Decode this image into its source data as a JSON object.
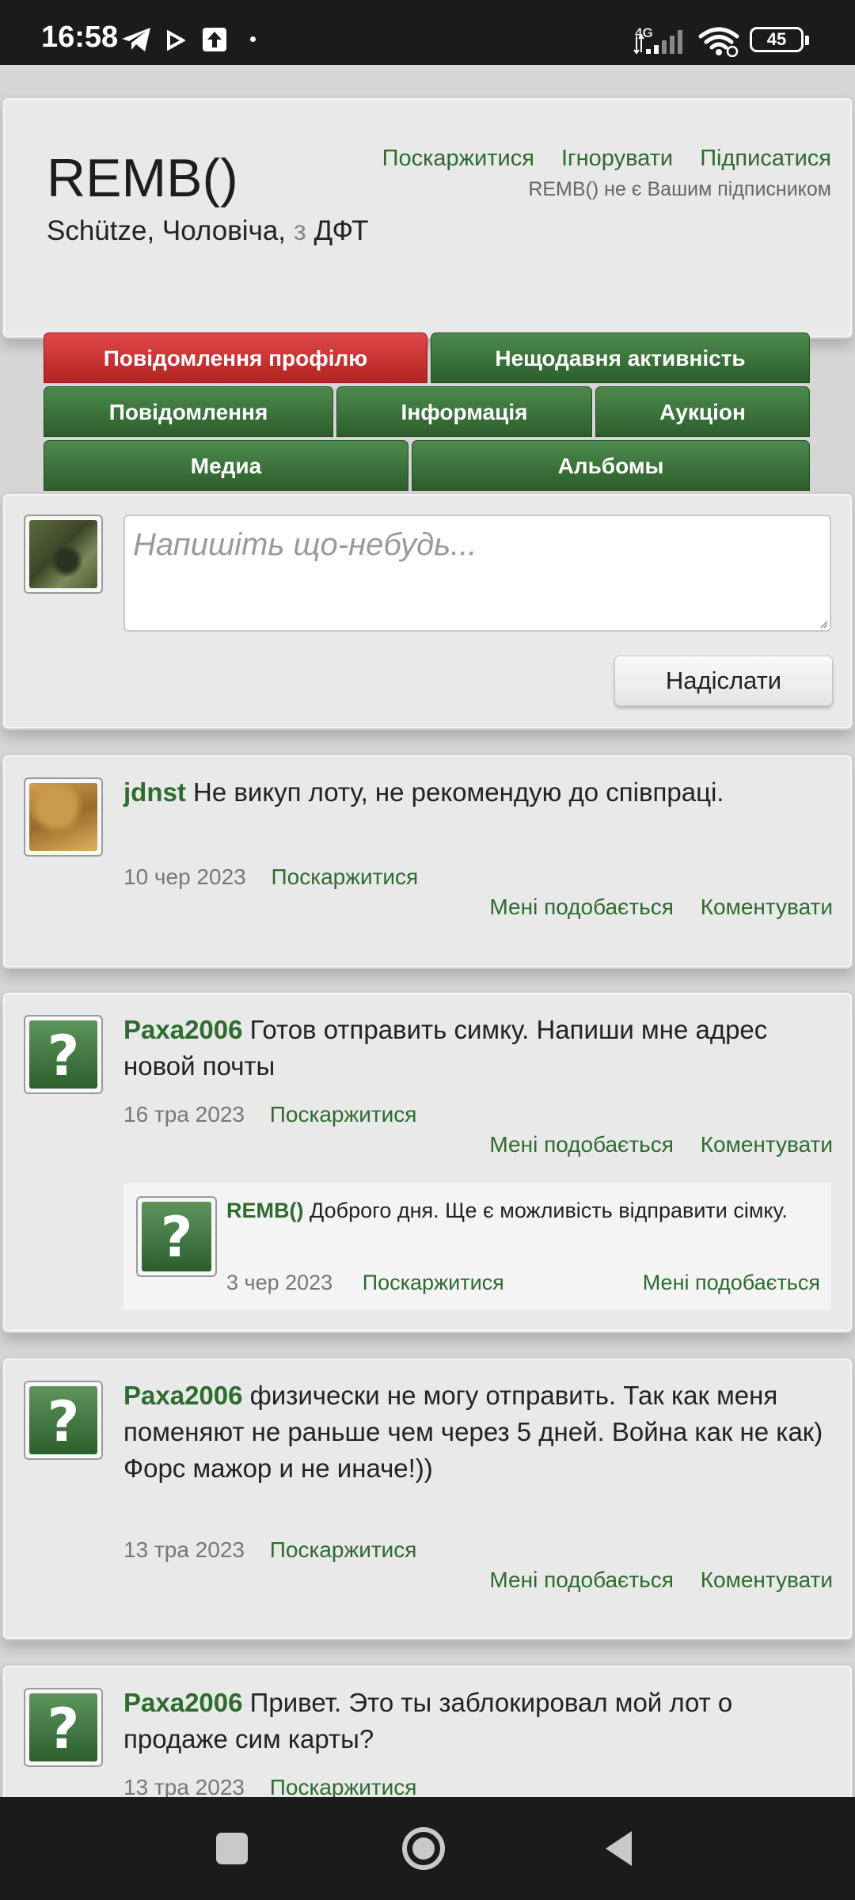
{
  "status": {
    "time": "16:58",
    "network": "4G",
    "battery": "45",
    "icons": [
      "telegram-icon",
      "play-icon",
      "upload-icon",
      "signal-icon",
      "wifi-icon",
      "battery-icon"
    ]
  },
  "profile": {
    "name": "REMB()",
    "subtitle_prefix": "Schütze, Чоловіча,",
    "subtitle_from": "з",
    "subtitle_place": "ДФТ",
    "links": {
      "report": "Поскаржитися",
      "ignore": "Ігнорувати",
      "follow": "Підписатися"
    },
    "follow_note": "REMB() не є Вашим підписником"
  },
  "tabs": {
    "profile_posts": "Повідомлення профілю",
    "recent_activity": "Нещодавня активність",
    "messages": "Повідомлення",
    "information": "Інформація",
    "auction": "Аукціон",
    "media": "Медиа",
    "albums": "Альбомы"
  },
  "composer": {
    "placeholder": "Напишіть що-небудь...",
    "submit_label": "Надіслати"
  },
  "labels": {
    "report": "Поскаржитися",
    "like": "Мені подобається",
    "comment": "Коментувати"
  },
  "posts": [
    {
      "user": "jdnst",
      "text": "Не викуп лоту, не рекомендую до співпраці.",
      "date": "10 чер 2023"
    },
    {
      "user": "Paxa2006",
      "text": "Готов отправить симку. Напиши мне адрес новой почты",
      "date": "16 тра 2023",
      "reply": {
        "user": "REMB()",
        "text": "Доброго дня. Ще є можливість відправити сімку.",
        "date": "3 чер 2023"
      }
    },
    {
      "user": "Paxa2006",
      "text": "физически не могу отправить. Так как меня поменяют не раньше чем через 5 дней. Война как не как)",
      "text2": "Форс мажор и не иначе!))",
      "date": "13 тра 2023"
    },
    {
      "user": "Paxa2006",
      "text": "Привет. Это ты заблокировал мой лот о продаже сим карты?",
      "date": "13 тра 2023"
    }
  ],
  "colors": {
    "link": "#2e6b2e",
    "tab_green": "#3b733b",
    "tab_active": "#c83434"
  }
}
